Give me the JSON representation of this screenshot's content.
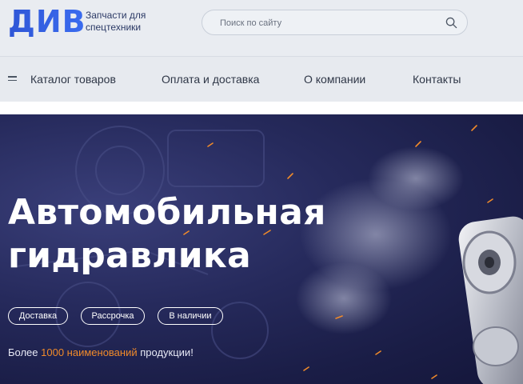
{
  "header": {
    "logo_text": "ДИВ",
    "tagline": "Запчасти для спецтехники",
    "search_placeholder": "Поиск по сайту",
    "search_icon": "search-icon"
  },
  "nav": {
    "menu_icon": "hamburger-icon",
    "items": [
      {
        "label": "Каталог товаров"
      },
      {
        "label": "Оплата и доставка"
      },
      {
        "label": "О компании"
      },
      {
        "label": "Контакты"
      }
    ]
  },
  "hero": {
    "title_line1": "Автомобильная",
    "title_line2": "гидравлика",
    "tags": [
      {
        "label": "Доставка"
      },
      {
        "label": "Рассрочка"
      },
      {
        "label": "В наличии"
      }
    ],
    "promo_prefix": "Более ",
    "promo_count": "1000",
    "promo_accent": " наименований",
    "promo_suffix": " продукции!"
  },
  "colors": {
    "accent": "#f08a2a",
    "brand": "#2f56d6",
    "hero_bg": "#1f2250"
  }
}
